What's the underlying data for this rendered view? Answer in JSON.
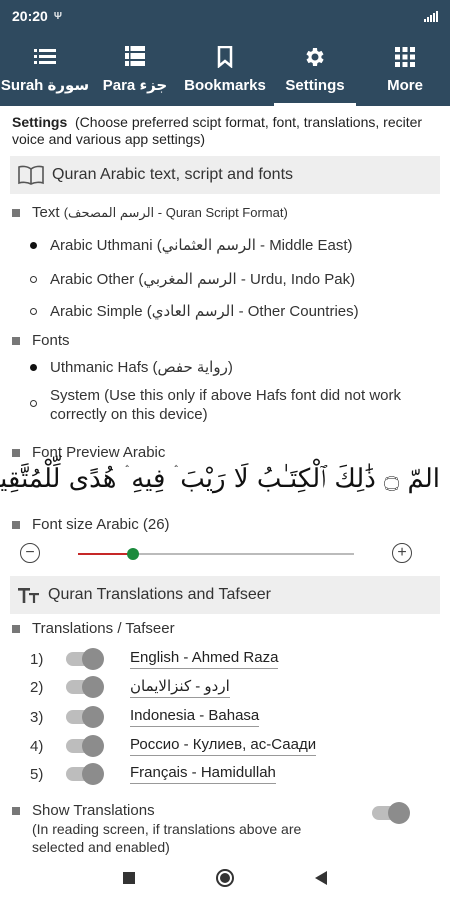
{
  "status_bar": {
    "time": "20:20",
    "indicator": "Ψ"
  },
  "nav": {
    "items": [
      {
        "label": "Surah سورة",
        "icon": "list-icon"
      },
      {
        "label": "Para جزء",
        "icon": "grid-list-icon"
      },
      {
        "label": "Bookmarks",
        "icon": "bookmark-icon"
      },
      {
        "label": "Settings",
        "icon": "gear-icon"
      },
      {
        "label": "More",
        "icon": "apps-grid-icon"
      }
    ],
    "active_index": 3
  },
  "settings": {
    "title": "Settings",
    "intro": "(Choose preferred scipt format, font, translations, reciter voice and various app settings)",
    "section1": {
      "header": "Quran Arabic text, script and fonts",
      "icon": "book-icon",
      "text_label": "Text",
      "text_sub": "(الرسم المصحف - Quran Script Format)",
      "text_options": [
        {
          "label": "Arabic Uthmani (الرسم العثماني - Middle East)",
          "selected": true
        },
        {
          "label": "Arabic Other (الرسم المغربي - Urdu, Indo Pak)",
          "selected": false
        },
        {
          "label": "Arabic Simple (الرسم العادي - Other Countries)",
          "selected": false
        }
      ],
      "fonts_label": "Fonts",
      "font_options": [
        {
          "label": "Uthmanic Hafs (رواية حفص)",
          "selected": true
        },
        {
          "label": "System (Use this only if above Hafs font did not work correctly on this device)",
          "selected": false
        }
      ],
      "preview_label": "Font Preview Arabic",
      "preview_text": "المّ ۝ ذَٰلِكَ ٱلْكِتَـٰبُ لَا رَيْبَ ۛ فِيهِ ۛ هُدًى لِّلْمُتَّقِينَ",
      "font_size_label": "Font size Arabic (26)",
      "font_size": {
        "value": 26,
        "fraction": 0.2
      }
    },
    "section2": {
      "header": "Quran Translations and Tafseer",
      "icon": "text-size-icon",
      "list_label": "Translations / Tafseer",
      "translations": [
        {
          "num": "1)",
          "name": "English - Ahmed Raza"
        },
        {
          "num": "2)",
          "name": "اردو - کنزالایمان"
        },
        {
          "num": "3)",
          "name": "Indonesia - Bahasa"
        },
        {
          "num": "4)",
          "name": "Россио - Кулиев, ас-Саади"
        },
        {
          "num": "5)",
          "name": "Français - Hamidullah"
        }
      ],
      "show_label": "Show Translations",
      "show_sub": "(In reading screen, if translations above are selected and enabled)"
    }
  },
  "colors": {
    "header_bg": "#2f4a5f",
    "slider_fill": "#c62828",
    "slider_thumb": "#1b8a3c"
  }
}
